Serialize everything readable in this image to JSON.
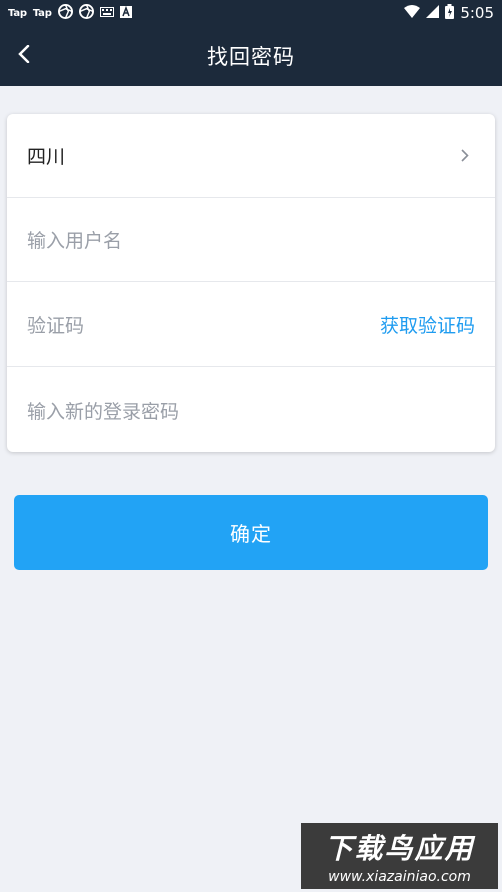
{
  "status_bar": {
    "apps": [
      "Tap",
      "Tap"
    ],
    "time": "5:05"
  },
  "header": {
    "title": "找回密码"
  },
  "form": {
    "region": "四川",
    "username_placeholder": "输入用户名",
    "code_placeholder": "验证码",
    "get_code_label": "获取验证码",
    "new_password_placeholder": "输入新的登录密码"
  },
  "confirm_label": "确定",
  "watermark": {
    "main": "下载鸟应用",
    "url": "www.xiazainiao.com"
  },
  "colors": {
    "header_bg": "#1c2a3b",
    "accent": "#22a3f5",
    "link": "#1f9cf0"
  }
}
